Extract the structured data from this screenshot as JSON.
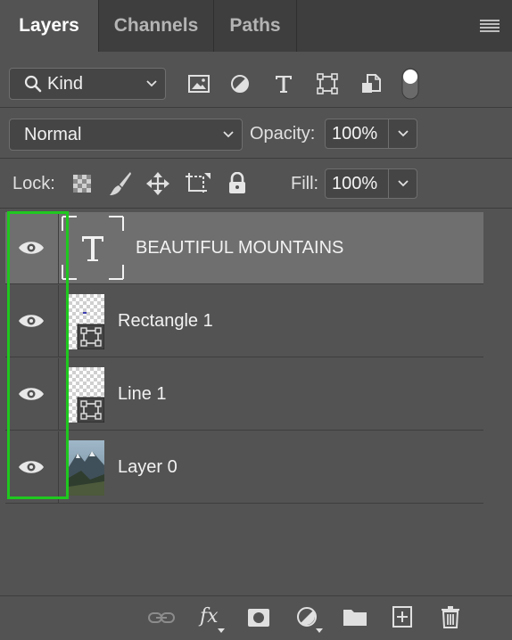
{
  "tabs": [
    {
      "label": "Layers",
      "active": true
    },
    {
      "label": "Channels",
      "active": false
    },
    {
      "label": "Paths",
      "active": false
    }
  ],
  "filter": {
    "kind_label": "Kind",
    "icons": [
      "image-filter-icon",
      "adjustment-filter-icon",
      "type-filter-icon",
      "shape-filter-icon",
      "smart-object-filter-icon",
      "filter-toggle-icon"
    ]
  },
  "blend": {
    "mode": "Normal",
    "opacity_label": "Opacity:",
    "opacity_value": "100%"
  },
  "lock": {
    "label": "Lock:",
    "fill_label": "Fill:",
    "fill_value": "100%"
  },
  "layers": [
    {
      "name": "BEAUTIFUL MOUNTAINS",
      "type": "text",
      "selected": true,
      "visible": true
    },
    {
      "name": "Rectangle 1",
      "type": "shape",
      "selected": false,
      "visible": true
    },
    {
      "name": "Line 1",
      "type": "shape",
      "selected": false,
      "visible": true
    },
    {
      "name": "Layer 0",
      "type": "image",
      "selected": false,
      "visible": true
    }
  ],
  "colors": {
    "panel_bg": "#535353",
    "tab_bg": "#3e3e3e",
    "selected_row": "#6f6f6f",
    "highlight": "#1fc81f"
  },
  "bottom_icons": [
    "link-layers-icon",
    "fx-icon",
    "add-mask-icon",
    "new-adjustment-icon",
    "new-group-icon",
    "new-layer-icon",
    "delete-layer-icon"
  ],
  "bottom_fx_label": "fx"
}
